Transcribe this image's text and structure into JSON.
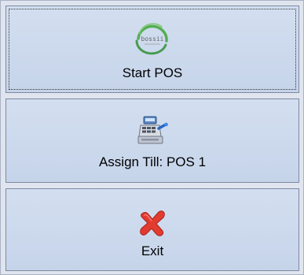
{
  "buttons": {
    "start_pos": {
      "label": "Start POS",
      "icon": "bossii-logo-icon",
      "logo_text": "bossii"
    },
    "assign_till": {
      "label": "Assign Till: POS 1",
      "icon": "cash-register-icon"
    },
    "exit": {
      "label": "Exit",
      "icon": "red-x-icon"
    }
  },
  "colors": {
    "button_bg": "#c6d4ea",
    "button_border": "#7c8aa3",
    "frame_bg": "#dfe4ee",
    "exit_red": "#e23b2f",
    "logo_green": "#3fa23a"
  }
}
